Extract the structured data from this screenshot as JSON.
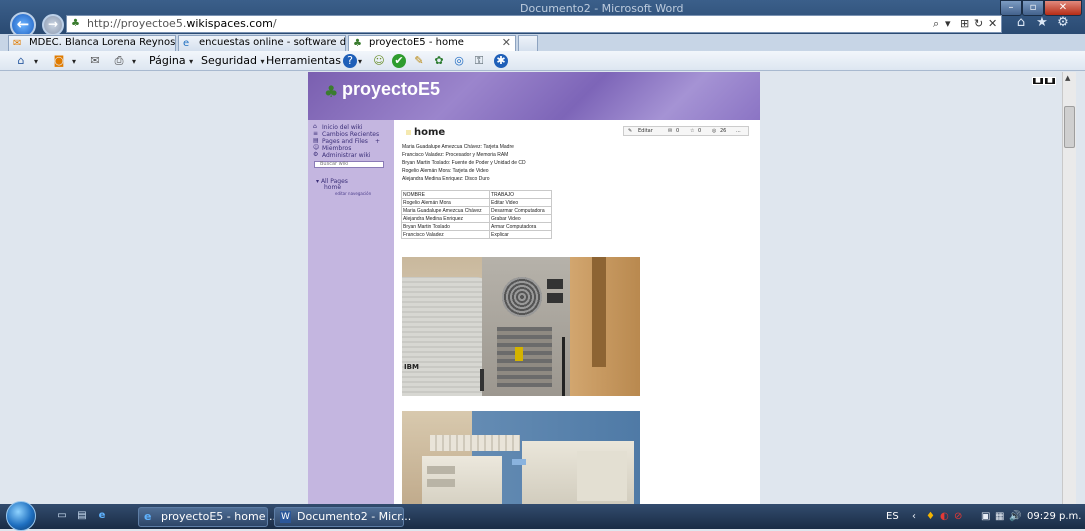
{
  "window": {
    "title": "Documento2 - Microsoft Word",
    "minimize": "–",
    "maximize": "▫",
    "close": "✕"
  },
  "browser": {
    "back": "←",
    "forward": "→",
    "address": {
      "prefix": "http://proyectoe5.",
      "domain": "wikispaces.com",
      "suffix": "/"
    },
    "addr_controls": {
      "search": "⌕",
      "dropdown": "▾",
      "compat": "⊞",
      "refresh": "↻",
      "stop": "✕"
    },
    "top_icons": {
      "home": "⌂",
      "favorites": "★",
      "tools": "⚙"
    },
    "tabs": [
      {
        "label": "MDEC. Blanca Lorena Reynoso...",
        "icon": "✉",
        "close": ""
      },
      {
        "label": "encuestas online - software de ...",
        "icon": "e",
        "close": ""
      },
      {
        "label": "proyectoE5 - home",
        "icon": "♣",
        "close": "✕"
      }
    ],
    "commands": {
      "pagina": "Página",
      "seguridad": "Seguridad",
      "herramientas": "Herramientas",
      "caret": "▾"
    },
    "toolbar_icons": [
      "⌂",
      "◙",
      "✉",
      "⎙",
      "?",
      "☺",
      "✔",
      "✎",
      "✿",
      "◎",
      "⚿",
      "✱"
    ]
  },
  "site": {
    "logo": "♣",
    "title": "proyectoE5",
    "nav": [
      {
        "label": "Inicio del wiki",
        "icon": "⌂"
      },
      {
        "label": "Cambios Recientes",
        "icon": "≡"
      },
      {
        "label": "Pages and Files",
        "icon": "▤",
        "extra": "+"
      },
      {
        "label": "Miembros",
        "icon": "☺"
      },
      {
        "label": "Administrar wiki",
        "icon": "⚙"
      }
    ],
    "search_placeholder": "Buscar wiki",
    "all_pages": "All Pages",
    "all_pages_toggle": "▾",
    "home_link": "home",
    "edit_navigation": "editar navegación",
    "page_title": "home",
    "pagebar": {
      "edit": "Editar",
      "count1": "0",
      "count2": "0",
      "count3": "26",
      "more": "..."
    },
    "assignments": [
      "Maria Guadalupe Amezcua Chávez: Tarjeta Madre",
      "Francisco Valadez: Procesador y Memoria RAM",
      "Bryan Martin Toslado: Fuente de Poder y Unidad de CD",
      "Rogelio Alemán Mora: Tarjeta de Video",
      "Alejandra Medina Enriquez: Disco Duro"
    ],
    "table": {
      "headers": [
        "NOMBRE",
        "TRABAJO"
      ],
      "rows": [
        [
          "Rogelio Alemán Mora",
          "Editar Video"
        ],
        [
          "Maria Guadalupe Amezcua Chávez",
          "Desarmar Computadora"
        ],
        [
          "Alejandra Medina Enriquez",
          "Grabar Video"
        ],
        [
          "Bryan Martin Toslado",
          "Armar Computadora"
        ],
        [
          "Francisco Valadez",
          "Explicar"
        ]
      ]
    },
    "photo_label": "IBM"
  },
  "taskbar": {
    "quick_launch": [
      "▭",
      "▤",
      "e"
    ],
    "tasks": [
      {
        "label": "proyectoE5 - home ...",
        "icon": "e"
      },
      {
        "label": "Documento2 - Micr...",
        "icon": "W"
      }
    ],
    "language": "ES",
    "tray_icons": [
      "‹",
      "♦",
      "◐",
      "⊘",
      "▣",
      "▦",
      "🔊"
    ],
    "clock": "09:29 p.m."
  }
}
